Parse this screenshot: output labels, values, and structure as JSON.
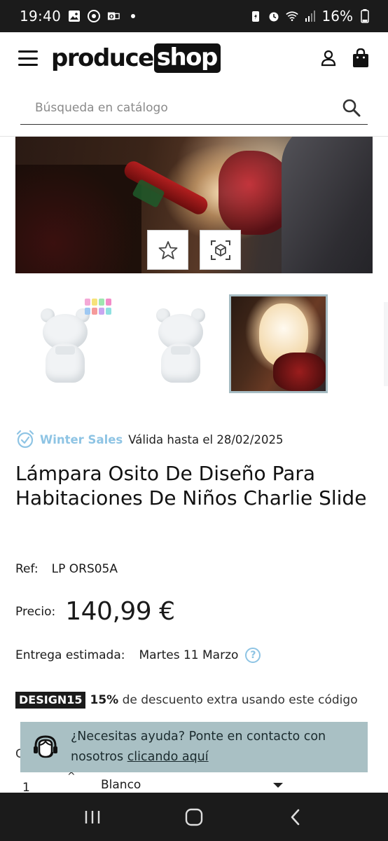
{
  "status_bar": {
    "time": "19:40",
    "battery": "16%"
  },
  "header": {
    "logo_part1": "produce",
    "logo_part2": "shop"
  },
  "search": {
    "placeholder": "Búsqueda en catálogo"
  },
  "promo": {
    "name": "Winter Sales",
    "validity": "Válida hasta el 28/02/2025"
  },
  "product": {
    "title": "Lámpara Osito De Diseño Para Habitaciones De Niños Charlie Slide",
    "ref_label": "Ref:",
    "ref_value": "LP ORS05A",
    "price_label": "Precio:",
    "price_value": "140,99 €",
    "delivery_label": "Entrega estimada:",
    "delivery_value": "Martes 11 Marzo",
    "help_mark": "?"
  },
  "coupon": {
    "code": "DESIGN15",
    "percent": "15%",
    "text": " de descuento extra usando este código"
  },
  "form": {
    "label_cut": "C",
    "quantity": "1",
    "quantity_up": "^",
    "color": "Blanco"
  },
  "help_banner": {
    "text": "¿Necesitas ayuda? Ponte en contacto con nosotros ",
    "link": "clicando aquí"
  },
  "colors": {
    "accent_light_blue": "#8ec4e4",
    "help_banner_bg": "#a9c0c4",
    "dark": "#1b1b1b"
  }
}
